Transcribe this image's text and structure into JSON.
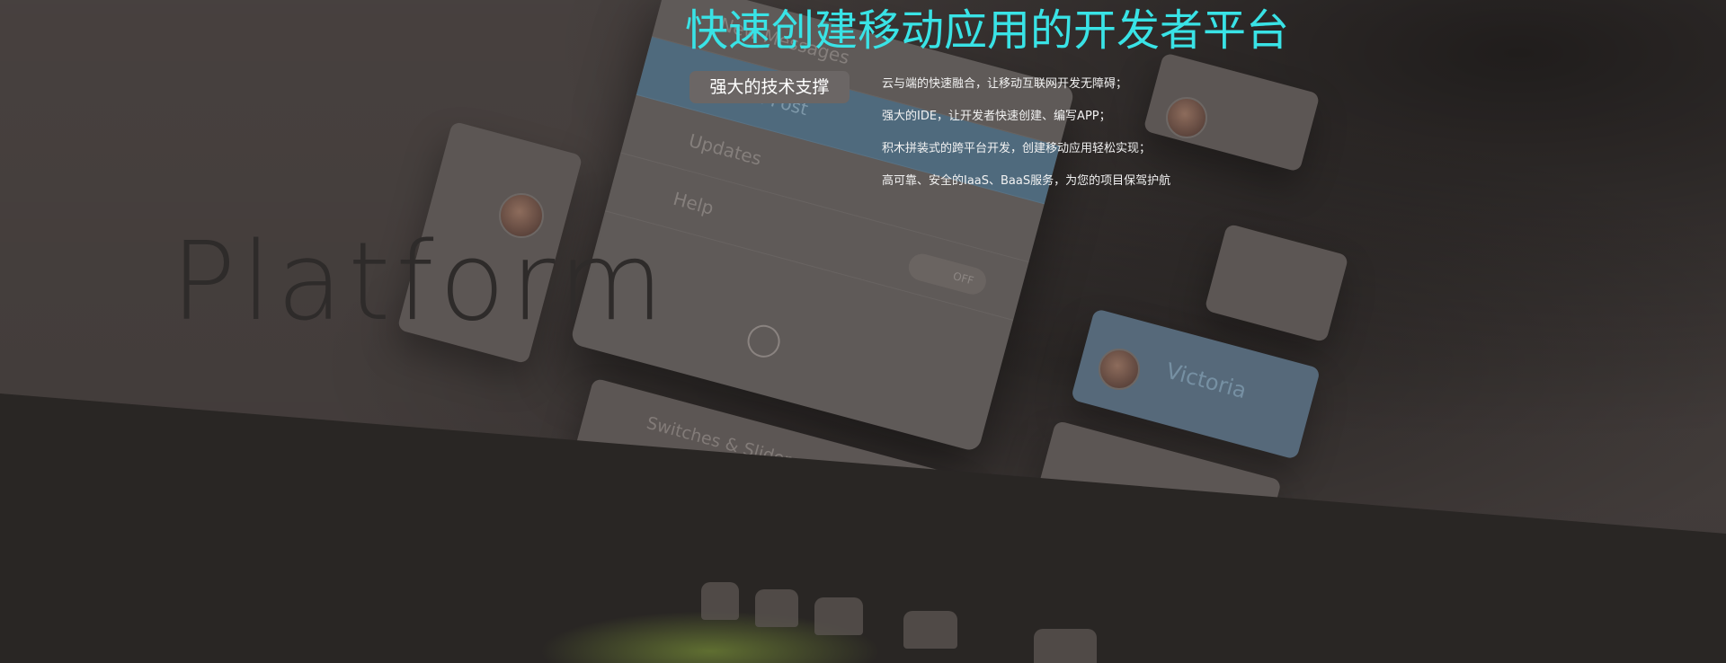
{
  "hero": {
    "title": "快速创建移动应用的开发者平台",
    "badge": "强大的技术支撑",
    "features": [
      "云与端的快速融合，让移动互联网开发无障碍；",
      "强大的IDE，让开发者快速创建、编写APP；",
      "积木拼装式的跨平台开发，创建移动应用轻松实现；",
      "高可靠、安全的IaaS、BaaS服务，为您的项目保驾护航"
    ]
  },
  "background": {
    "word": "Platform",
    "phone_rows": [
      "New Messages",
      "Upload Post",
      "Updates",
      "Help"
    ],
    "toggle_label": "OFF",
    "card_labels": [
      "Switches & Sliders",
      "Victoria"
    ],
    "colors": {
      "accent": "#39e3e6",
      "bg": "#4b4442",
      "floor": "#292624",
      "badge": "#6b6665"
    }
  }
}
